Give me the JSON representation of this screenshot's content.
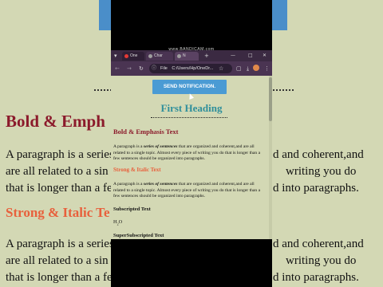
{
  "recorder_watermark": "www.BANDICAM.com",
  "background_page": {
    "heading1": "Bold & Emph",
    "heading2": "Strong & Italic Te",
    "para_left": [
      "A paragraph is a series",
      "are all related to a sin",
      "that is longer than a fe"
    ],
    "para_right": [
      "d and coherent,and",
      "writing you do",
      "d into paragraphs."
    ],
    "para2_left": [
      "A paragraph is a series",
      "are all related to a sin",
      "that is longer than a fe"
    ],
    "para2_right": [
      "d and coherent,and",
      "writing you do",
      "d into paragraphs."
    ]
  },
  "browser": {
    "tabs": [
      {
        "label": "One",
        "color": "#e53935"
      },
      {
        "label": "Char",
        "color": "#9e9e9e"
      },
      {
        "label": "N",
        "color": "#9e9e9e"
      }
    ],
    "new_tab": "+",
    "window_controls": {
      "minimize": "—",
      "maximize": "□",
      "close": "✕"
    },
    "url_prefix": "File",
    "url": "C:/Users/Hp/OneDr...",
    "colors": {
      "tabbar": "#3b2a42",
      "addrbar": "#4a3452"
    }
  },
  "page": {
    "button": "SEND NOTIFICATION.",
    "title": "First Heading",
    "section1_heading": "Bold & Emphasis Text",
    "section1_para": "A paragraph is a series of sentences that are organized and coherent,and are all related to a single topic. Almost every piece of writing you do that is longer than a few sentences should be organized into paragraphs.",
    "section2_heading": "Strong & Italic Text",
    "section2_para": "A paragraph is a series of sentences that are organized and coherent,and are all related to a single topic. Almost every piece of writing you do that is longer than a few sentences should be organized into paragraphs.",
    "subscripted_heading": "Subscripted Text",
    "subscripted_value": "H2O",
    "superscripted_heading": "SuperSubscripted Text",
    "colors": {
      "title": "#2f8f9b",
      "heading1": "#8b1a2b",
      "heading2": "#e8603c",
      "button": "#4a9bd4"
    }
  }
}
